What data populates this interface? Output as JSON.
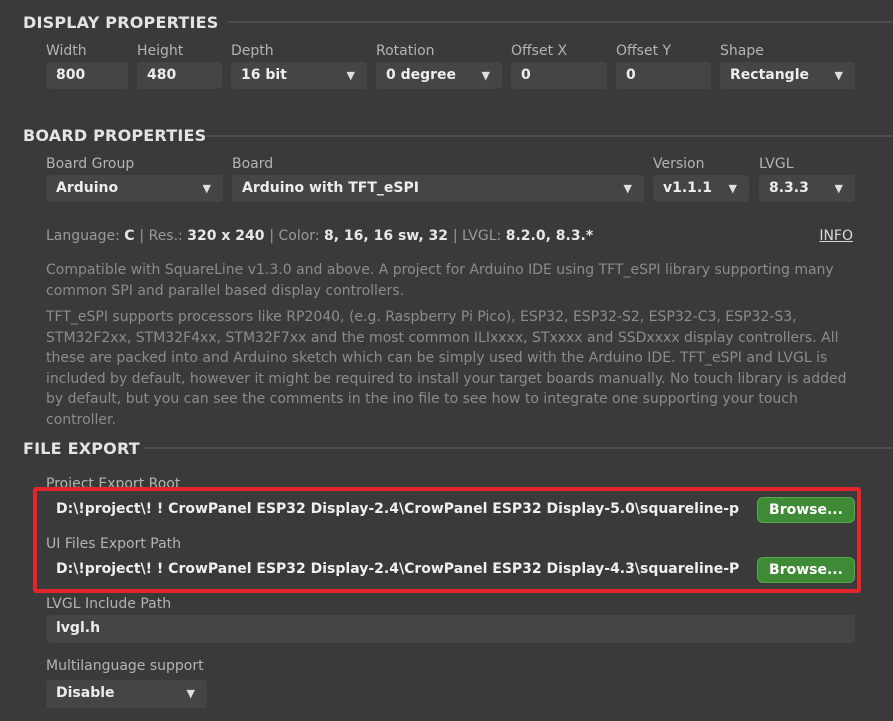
{
  "display_properties": {
    "header": "DISPLAY PROPERTIES",
    "width_label": "Width",
    "width_value": "800",
    "height_label": "Height",
    "height_value": "480",
    "depth_label": "Depth",
    "depth_value": "16 bit",
    "rotation_label": "Rotation",
    "rotation_value": "0 degree",
    "offset_x_label": "Offset X",
    "offset_x_value": "0",
    "offset_y_label": "Offset Y",
    "offset_y_value": "0",
    "shape_label": "Shape",
    "shape_value": "Rectangle"
  },
  "board_properties": {
    "header": "BOARD PROPERTIES",
    "board_group_label": "Board Group",
    "board_group_value": "Arduino",
    "board_label": "Board",
    "board_value": "Arduino with TFT_eSPI",
    "version_label": "Version",
    "version_value": "v1.1.1",
    "lvgl_label": "LVGL",
    "lvgl_value": "8.3.3",
    "info": {
      "language_label": "Language:",
      "language_value": "C",
      "res_label": "Res.:",
      "res_value": "320 x 240",
      "color_label": "Color:",
      "color_value": "8, 16, 16 sw, 32",
      "lvgl_label": "LVGL:",
      "lvgl_value": "8.2.0, 8.3.*",
      "separator": "|",
      "info_link": "INFO"
    },
    "description_1": "Compatible with SquareLine v1.3.0 and above. A project for Arduino IDE using TFT_eSPI library supporting many common SPI and parallel based display controllers.",
    "description_2": "TFT_eSPI supports processors like RP2040, (e.g. Raspberry Pi Pico), ESP32, ESP32-S2, ESP32-C3, ESP32-S3, STM32F2xx, STM32F4xx, STM32F7xx and the most common ILIxxxx, STxxxx and SSDxxxx display controllers. All these are packed into and Arduino sketch which can be simply used with the Arduino IDE. TFT_eSPI and LVGL is included by default, however it might be required to install your target boards manually.  No touch library is added by default, but you can see the comments in the ino file to see how to integrate one supporting your touch controller."
  },
  "file_export": {
    "header": "FILE EXPORT",
    "project_export_root_label": "Project Export Root",
    "project_export_root_value": "D:\\!project\\!  !  CrowPanel ESP32 Display-2.4\\CrowPanel ESP32 Display-5.0\\squareline-proj",
    "ui_files_export_path_label": "UI Files Export Path",
    "ui_files_export_path_value": "D:\\!project\\!  !  CrowPanel ESP32 Display-2.4\\CrowPanel ESP32 Display-4.3\\squareline-Proj",
    "browse_label": "Browse...",
    "lvgl_include_path_label": "LVGL Include Path",
    "lvgl_include_path_value": "lvgl.h",
    "multilanguage_label": "Multilanguage support",
    "multilanguage_value": "Disable"
  },
  "colors": {
    "background": "#3a3a3a",
    "field": "#454545",
    "browse_button": "#3f8a36",
    "highlight": "#e3242b"
  },
  "icons": {
    "dropdown": "triangle-down-icon"
  }
}
